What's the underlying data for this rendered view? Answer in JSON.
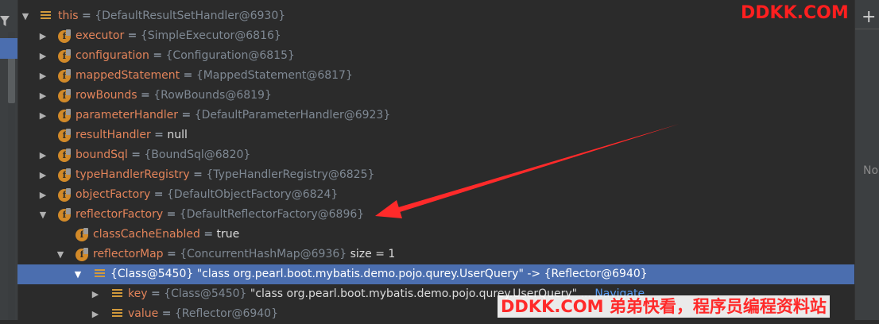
{
  "tree": {
    "rows": [
      {
        "name": "this",
        "eq": " = ",
        "value": "{DefaultResultSetHandler@6930}",
        "suffix": ""
      },
      {
        "name": "executor",
        "eq": " = ",
        "value": "{SimpleExecutor@6816}",
        "suffix": ""
      },
      {
        "name": "configuration",
        "eq": " = ",
        "value": "{Configuration@6815}",
        "suffix": ""
      },
      {
        "name": "mappedStatement",
        "eq": " = ",
        "value": "{MappedStatement@6817}",
        "suffix": ""
      },
      {
        "name": "rowBounds",
        "eq": " = ",
        "value": "{RowBounds@6819}",
        "suffix": ""
      },
      {
        "name": "parameterHandler",
        "eq": " = ",
        "value": "{DefaultParameterHandler@6923}",
        "suffix": ""
      },
      {
        "name": "resultHandler",
        "eq": " = ",
        "value": "null",
        "suffix": ""
      },
      {
        "name": "boundSql",
        "eq": " = ",
        "value": "{BoundSql@6820}",
        "suffix": ""
      },
      {
        "name": "typeHandlerRegistry",
        "eq": " = ",
        "value": "{TypeHandlerRegistry@6825}",
        "suffix": ""
      },
      {
        "name": "objectFactory",
        "eq": " = ",
        "value": "{DefaultObjectFactory@6824}",
        "suffix": ""
      },
      {
        "name": "reflectorFactory",
        "eq": " = ",
        "value": "{DefaultReflectorFactory@6896}",
        "suffix": ""
      },
      {
        "name": "classCacheEnabled",
        "eq": " = ",
        "value": "true",
        "suffix": ""
      },
      {
        "name": "reflectorMap",
        "eq": " = ",
        "value": "{ConcurrentHashMap@6936}",
        "suffix": " size = 1"
      },
      {
        "name": "",
        "eq": "",
        "value": "{Class@5450}",
        "suffix": " \"class org.pearl.boot.mybatis.demo.pojo.qurey.UserQuery\" -> {Reflector@6940}"
      },
      {
        "name": "key",
        "eq": " = ",
        "value": "{Class@5450}",
        "suffix": " \"class org.pearl.boot.mybatis.demo.pojo.qurey.UserQuery\"",
        "more": " ... ",
        "link": "Navigate"
      },
      {
        "name": "value",
        "eq": " = ",
        "value": "{Reflector@6940}",
        "suffix": ""
      }
    ]
  },
  "side": {
    "plus": "+",
    "no_text": "No"
  },
  "watermarks": {
    "top": "DDKK.COM",
    "bottom": "DDKK.COM 弟弟快看，程序员编程资料站"
  },
  "colors": {
    "selection": "#4b6eaf",
    "field_badge": "#d28a29",
    "field_name": "#e3845a",
    "annotation_arrow": "#ff2a2a"
  }
}
